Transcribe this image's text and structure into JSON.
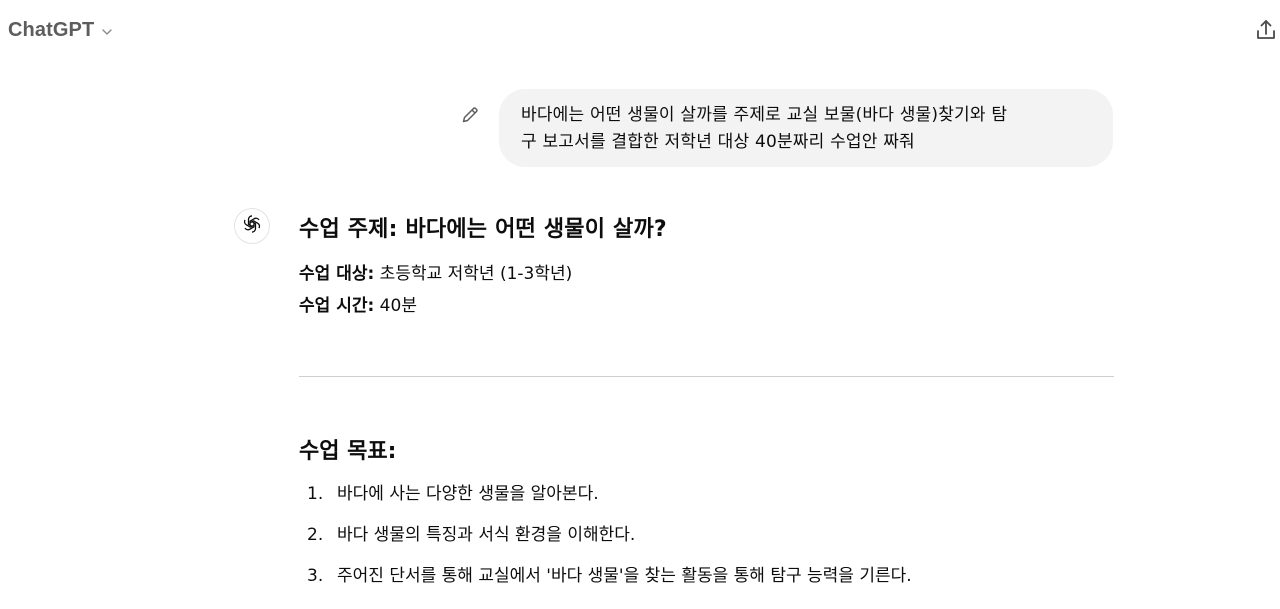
{
  "header": {
    "model_name": "ChatGPT",
    "icons": [
      "chevron-down-icon",
      "share-icon"
    ]
  },
  "user_message": {
    "line1": "바다에는 어떤 생물이 살까를 주제로 교실 보물(바다 생물)찾기와 탐",
    "line2": "구 보고서를 결합한 저학년 대상 40분짜리 수업안 짜줘",
    "edit_icon": "pencil-icon"
  },
  "assistant": {
    "avatar_icon": "openai-logo-icon",
    "title": "수업 주제: 바다에는 어떤 생물이 살까?",
    "target_label": "수업 대상:",
    "target_value": " 초등학교 저학년 (1-3학년)",
    "time_label": "수업 시간:",
    "time_value": " 40분",
    "goals_heading": "수업 목표:",
    "goals": [
      {
        "num": "1.",
        "text": "바다에 사는 다양한 생물을 알아본다."
      },
      {
        "num": "2.",
        "text": "바다 생물의 특징과 서식 환경을 이해한다."
      },
      {
        "num": "3.",
        "text": "주어진 단서를 통해 교실에서 '바다 생물'을 찾는 활동을 통해 탐구 능력을 기른다."
      }
    ]
  },
  "colors": {
    "bubble_bg": "#f3f3f3",
    "text": "#0d0d0d",
    "muted": "#5d5d5d",
    "divider": "#cfcfcf"
  }
}
